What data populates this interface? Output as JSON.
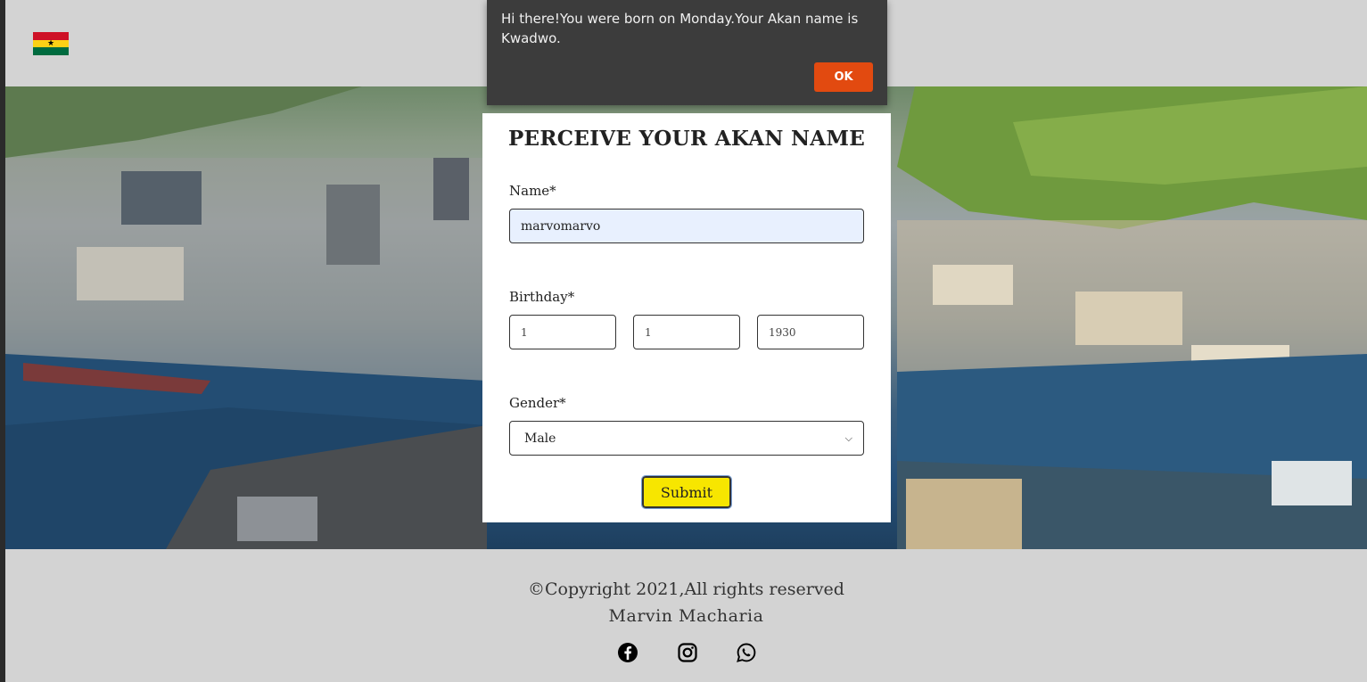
{
  "header": {
    "flag_icon": "ghana-flag-icon",
    "flag_colors": [
      "#ce1126",
      "#fcd116",
      "#006b3f"
    ]
  },
  "alert": {
    "message": "Hi there!You were born on Monday.Your Akan name is Kwadwo.",
    "ok_label": "OK",
    "ok_color": "#e24a10"
  },
  "form": {
    "title": "PERCEIVE YOUR AKAN NAME",
    "name_label": "Name*",
    "name_value": "marvomarvo",
    "birthday_label": "Birthday*",
    "day_value": "1",
    "month_value": "1",
    "year_value": "1930",
    "gender_label": "Gender*",
    "gender_value": "Male",
    "submit_label": "Submit",
    "submit_color": "#f7e600"
  },
  "footer": {
    "copyright": "©Copyright 2021,All rights reserved",
    "author": "Marvin Macharia",
    "social_icons": [
      "facebook-icon",
      "instagram-icon",
      "whatsapp-icon"
    ]
  }
}
